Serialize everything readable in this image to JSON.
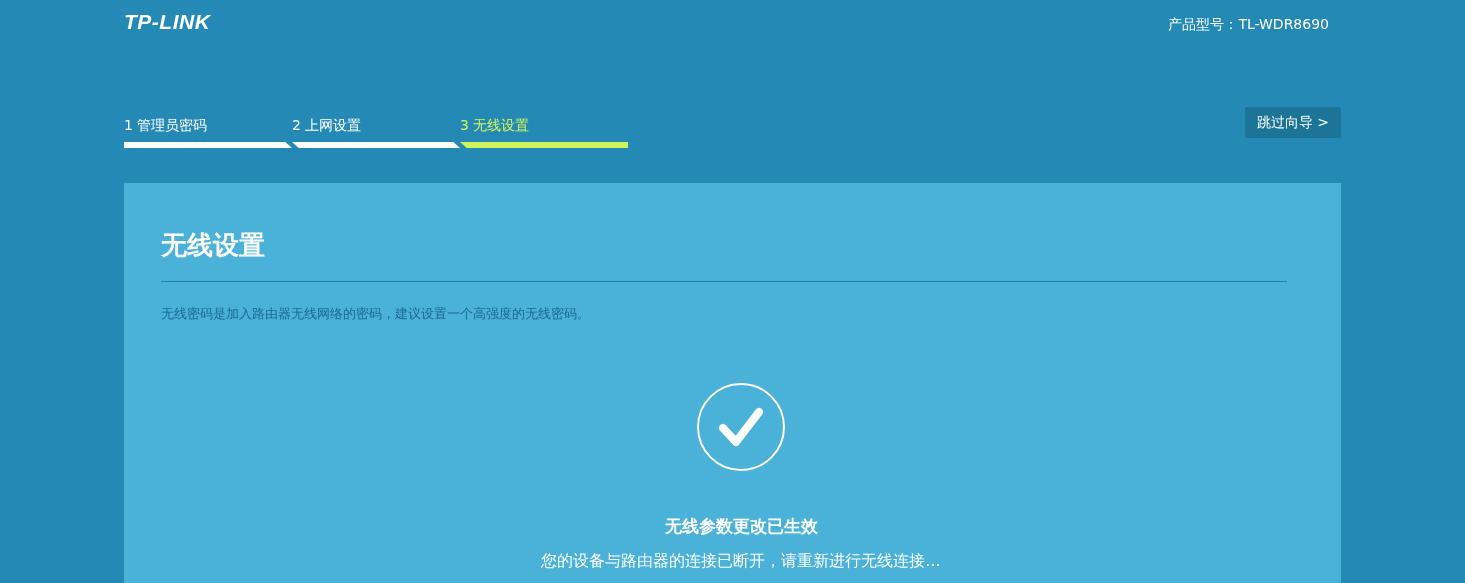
{
  "header": {
    "logo": "TP-LINK",
    "model": "产品型号：TL-WDR8690"
  },
  "steps": [
    {
      "label": "1 管理员密码",
      "selected": false
    },
    {
      "label": "2 上网设置",
      "selected": false
    },
    {
      "label": "3 无线设置",
      "selected": true
    }
  ],
  "skip_button": "跳过向导 >",
  "card": {
    "title": "无线设置",
    "description": "无线密码是加入路由器无线网络的密码，建议设置一个高强度的无线密码。",
    "status_title": "无线参数更改已生效",
    "status_message": "您的设备与路由器的连接已断开，请重新进行无线连接..."
  }
}
